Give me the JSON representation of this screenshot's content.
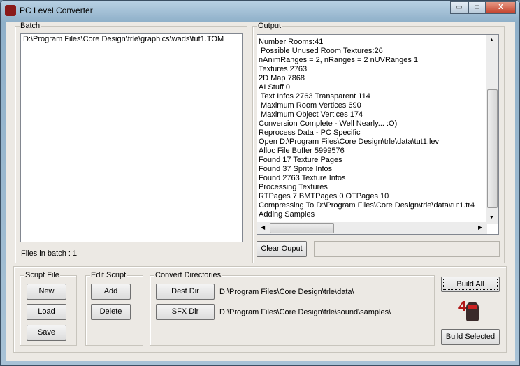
{
  "window": {
    "title": "PC Level Converter",
    "controls": {
      "minimize": "▭",
      "maximize": "□",
      "close": "X"
    }
  },
  "batch": {
    "label": "Batch",
    "items": [
      "D:\\Program Files\\Core Design\\trle\\graphics\\wads\\tut1.TOM"
    ],
    "files_label": "Files in batch :",
    "files_count": "1"
  },
  "output": {
    "label": "Output",
    "lines": [
      "Number Rooms:41",
      " Possible Unused Room Textures:26",
      "nAnimRanges = 2, nRanges = 2 nUVRanges 1",
      "Textures 2763",
      "2D Map 7868",
      "AI Stuff 0",
      " Text Infos 2763 Transparent 114",
      " Maximum Room Vertices 690",
      " Maximum Object Vertices 174",
      "Conversion Complete - Well Nearly... :O)",
      "Reprocess Data - PC Specific",
      "Open D:\\Program Files\\Core Design\\trle\\data\\tut1.lev",
      "Alloc File Buffer 5999576",
      "Found 17 Texture Pages",
      "Found 37 Sprite Infos",
      "Found 2763 Texture Infos",
      "Processing Textures",
      "RTPages 7 BMTPages 0 OTPages 10",
      "Compressing To D:\\Program Files\\Core Design\\trle\\data\\tut1.tr4",
      "Adding Samples"
    ],
    "clear_label": "Clear Ouput",
    "status": ""
  },
  "script_file": {
    "label": "Script File",
    "new": "New",
    "load": "Load",
    "save": "Save"
  },
  "edit_script": {
    "label": "Edit Script",
    "add": "Add",
    "delete": "Delete"
  },
  "convert": {
    "label": "Convert Directories",
    "dest_label": "Dest Dir",
    "dest_path": "D:\\Program Files\\Core Design\\trle\\data\\",
    "sfx_label": "SFX Dir",
    "sfx_path": "D:\\Program Files\\Core Design\\trle\\sound\\samples\\"
  },
  "build": {
    "all": "Build All",
    "selected": "Build Selected",
    "logo_text": "4"
  }
}
